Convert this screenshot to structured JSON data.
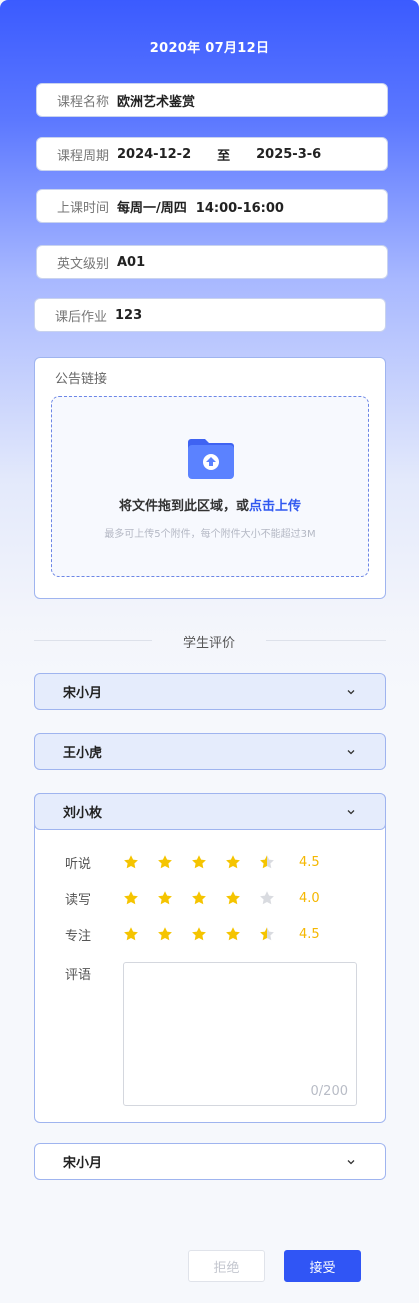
{
  "header": {
    "date": "2020年 07月12日"
  },
  "course": {
    "name_label": "课程名称",
    "name_value": "欧洲艺术鉴赏",
    "period_label": "课程周期",
    "period_start": "2024-12-2",
    "period_to": "至",
    "period_end": "2025-3-6",
    "time_label": "上课时间",
    "time_value": "每周一/周四  14:00-16:00",
    "level_label": "英文级别",
    "level_value": "A01",
    "homework_label": "课后作业",
    "homework_value": "123"
  },
  "notice": {
    "title": "公告链接",
    "upload_text": "将文件拖到此区域，或",
    "upload_link": "点击上传",
    "upload_hint": "最多可上传5个附件，每个附件大小不能超过3M"
  },
  "evaluation": {
    "section_title": "学生评价",
    "students": [
      {
        "name": "宋小月"
      },
      {
        "name": "王小虎"
      },
      {
        "name": "刘小枚"
      },
      {
        "name": "宋小月"
      }
    ],
    "ratings": [
      {
        "label": "听说",
        "score": "4.5",
        "value": 4.5
      },
      {
        "label": "读写",
        "score": "4.0",
        "value": 4.0
      },
      {
        "label": "专注",
        "score": "4.5",
        "value": 4.5
      }
    ],
    "comment_label": "评语",
    "comment_count": "0/200"
  },
  "actions": {
    "reject": "拒绝",
    "accept": "接受"
  },
  "colors": {
    "primary": "#3055f5",
    "star": "#f5c400",
    "star_empty": "#d9dbe0"
  },
  "icons": {
    "folder": "folder-upload-icon",
    "chevron": "chevron-down-icon",
    "star": "star-icon"
  }
}
